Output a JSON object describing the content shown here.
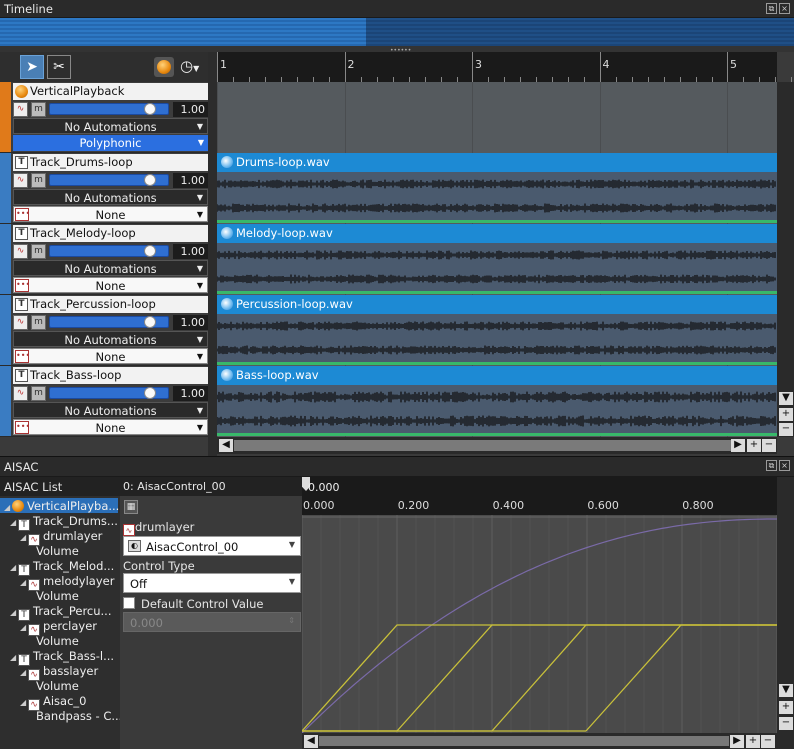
{
  "timeline": {
    "title": "Timeline",
    "ruler_marks": [
      "1",
      "2",
      "3",
      "4",
      "5"
    ],
    "tracks": [
      {
        "name": "VerticalPlayback",
        "icon": "orb-icon",
        "volume": "1.00",
        "volume_fraction": 0.85,
        "automation": "No Automations",
        "mode": "Polyphonic",
        "color": "#e07a1a"
      },
      {
        "name": "Track_Drums-loop",
        "icon": "T",
        "volume": "1.00",
        "volume_fraction": 0.85,
        "automation": "No Automations",
        "mode": "None",
        "color": "#3a7cc2",
        "clip": "Drums-loop.wav"
      },
      {
        "name": "Track_Melody-loop",
        "icon": "T",
        "volume": "1.00",
        "volume_fraction": 0.85,
        "automation": "No Automations",
        "mode": "None",
        "color": "#3a7cc2",
        "clip": "Melody-loop.wav"
      },
      {
        "name": "Track_Percussion-loop",
        "icon": "T",
        "volume": "1.00",
        "volume_fraction": 0.85,
        "automation": "No Automations",
        "mode": "None",
        "color": "#3a7cc2",
        "clip": "Percussion-loop.wav"
      },
      {
        "name": "Track_Bass-loop",
        "icon": "T",
        "volume": "1.00",
        "volume_fraction": 0.85,
        "automation": "No Automations",
        "mode": "None",
        "color": "#3a7cc2",
        "clip": "Bass-loop.wav"
      }
    ]
  },
  "aisac": {
    "title": "AISAC",
    "list_header": "AISAC List",
    "tree": [
      {
        "label": "VerticalPlayba...",
        "level": 0,
        "icon": "orb"
      },
      {
        "label": "Track_Drums...",
        "level": 1,
        "icon": "T"
      },
      {
        "label": "drumlayer",
        "level": 2,
        "icon": "A"
      },
      {
        "label": "Volume",
        "level": 3,
        "icon": ""
      },
      {
        "label": "Track_Melod...",
        "level": 1,
        "icon": "T"
      },
      {
        "label": "melodylayer",
        "level": 2,
        "icon": "A"
      },
      {
        "label": "Volume",
        "level": 3,
        "icon": ""
      },
      {
        "label": "Track_Percu...",
        "level": 1,
        "icon": "T"
      },
      {
        "label": "perclayer",
        "level": 2,
        "icon": "A"
      },
      {
        "label": "Volume",
        "level": 3,
        "icon": ""
      },
      {
        "label": "Track_Bass-l...",
        "level": 1,
        "icon": "T"
      },
      {
        "label": "basslayer",
        "level": 2,
        "icon": "A"
      },
      {
        "label": "Volume",
        "level": 3,
        "icon": ""
      },
      {
        "label": "Aisac_0",
        "level": 2,
        "icon": "A"
      },
      {
        "label": "Bandpass - C...",
        "level": 3,
        "icon": ""
      }
    ],
    "control_header": "0: AisacControl_00",
    "layer_name": "drumlayer",
    "control_select": "AisacControl_00",
    "control_type_label": "Control Type",
    "control_type_value": "Off",
    "default_label": "Default Control Value",
    "default_value": "0.000",
    "cursor_value": "0.000",
    "axis_marks": [
      "0.000",
      "0.200",
      "0.400",
      "0.600",
      "0.800"
    ]
  },
  "colors": {
    "accent_blue": "#1d8ad4",
    "selection": "#2b6fb8",
    "curve_yellow": "#c8c03a",
    "curve_purple": "#7a6aa8"
  }
}
